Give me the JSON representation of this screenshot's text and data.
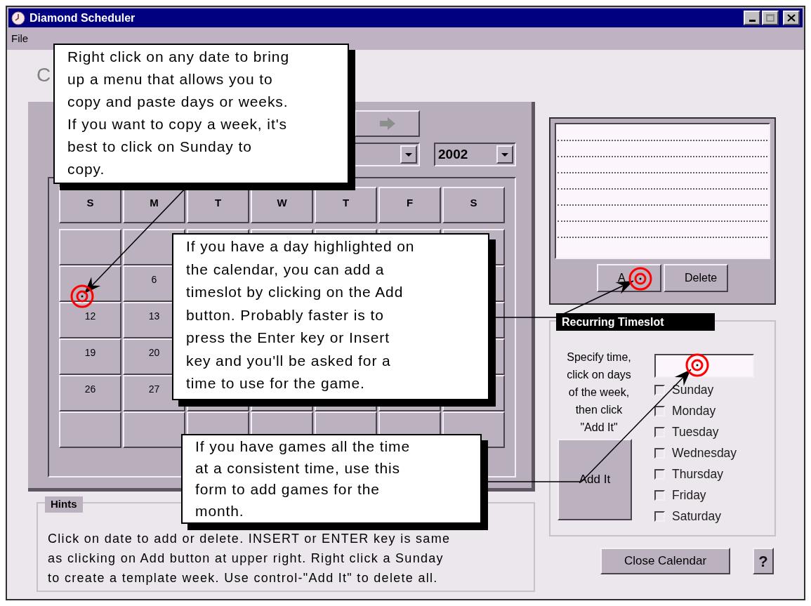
{
  "window": {
    "title": "Diamond Scheduler"
  },
  "menu": [
    {
      "label": "File"
    }
  ],
  "heading": "C",
  "calendar": {
    "year": "2002",
    "weekdays": [
      "S",
      "M",
      "T",
      "W",
      "T",
      "F",
      "S"
    ],
    "weeks": [
      {
        "mon": "6"
      },
      {
        "sun": "12",
        "mon": "13"
      },
      {
        "sun": "19",
        "mon": "20"
      },
      {
        "sun": "26",
        "mon": "27"
      }
    ]
  },
  "timeslots": {
    "buttons": [
      {
        "label": "A"
      },
      {
        "label": "Delete"
      }
    ]
  },
  "recurring": {
    "title": "Recurring Timeslot",
    "instructions": [
      "Specify time,",
      "click on days",
      "of the week,",
      "then click",
      "\"Add It\""
    ],
    "days": [
      {
        "label": "Sunday",
        "checked": false
      },
      {
        "label": "Monday",
        "checked": false
      },
      {
        "label": "Tuesday",
        "checked": false
      },
      {
        "label": "Wednesday",
        "checked": false
      },
      {
        "label": "Thursday",
        "checked": false
      },
      {
        "label": "Friday",
        "checked": false
      },
      {
        "label": "Saturday",
        "checked": false
      }
    ],
    "add_button": "Add It"
  },
  "hints": {
    "title": "Hints",
    "lines": [
      "Click on date to add or delete. INSERT or ENTER key is same",
      "as clicking on Add button at upper right. Right click a Sunday",
      "to create a template week. Use control-\"Add It\" to delete all."
    ]
  },
  "footer": {
    "close_button": {
      "label": "Close Calendar"
    },
    "help_button": "?"
  },
  "callouts": [
    {
      "lines": [
        "Right click on any date to bring",
        "up a menu that allows you to",
        "copy and paste days or weeks.",
        "If you want to copy a week, it's",
        "best to click on Sunday to",
        "copy."
      ]
    },
    {
      "lines": [
        "If you have a day highlighted on",
        "the calendar, you can add a",
        "timeslot by clicking on the Add",
        "button. Probably faster is to",
        "press the Enter key or Insert",
        "key and you'll be asked for a",
        "time to use for the game."
      ]
    },
    {
      "lines": [
        "If you have games all the time",
        "at a consistent time, use this",
        "form to add games for the",
        "month."
      ]
    }
  ]
}
